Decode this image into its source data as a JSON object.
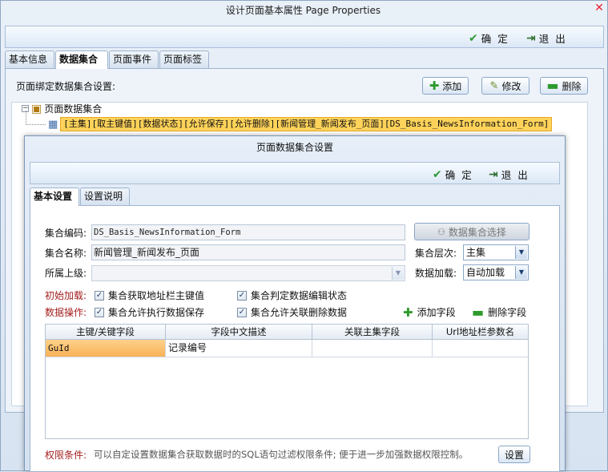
{
  "outer": {
    "title": "设计页面基本属性  Page Properties",
    "close": "✕",
    "toolbar": {
      "ok": "确 定",
      "exit": "退 出"
    },
    "tabs": [
      "基本信息",
      "数据集合",
      "页面事件",
      "页面标签"
    ],
    "active_tab": "数据集合",
    "binding_label": "页面绑定数据集合设置:",
    "buttons": {
      "add": "添加",
      "edit": "修改",
      "delete": "删除"
    },
    "tree": {
      "root": "页面数据集合",
      "child": "[主集][取主键值][数据状态][允许保存][允许删除][新闻管理_新闻发布_页面][DS_Basis_NewsInformation_Form]"
    }
  },
  "dialog": {
    "title": "页面数据集合设置",
    "toolbar": {
      "ok": "确 定",
      "exit": "退 出"
    },
    "tabs": [
      "基本设置",
      "设置说明"
    ],
    "active_tab": "基本设置",
    "fields": {
      "code_label": "集合编码:",
      "code_value": "DS_Basis_NewsInformation_Form",
      "select_button": "数据集合选择",
      "name_label": "集合名称:",
      "name_value": "新闻管理_新闻发布_页面",
      "level_label": "集合层次:",
      "level_value": "主集",
      "parent_label": "所属上级:",
      "parent_value": "",
      "load_label": "数据加载:",
      "load_value": "自动加载"
    },
    "init_load": {
      "label": "初始加载:",
      "opt1": "集合获取地址栏主键值",
      "opt2": "集合判定数据编辑状态"
    },
    "data_ops": {
      "label": "数据操作:",
      "opt1": "集合允许执行数据保存",
      "opt2": "集合允许关联删除数据"
    },
    "add_field": "添加字段",
    "delete_field": "删除字段",
    "grid": {
      "columns": [
        "主键/关键字段",
        "字段中文描述",
        "关联主集字段",
        "Url地址栏参数名"
      ],
      "rows": [
        [
          "GuId",
          "记录编号",
          "",
          ""
        ]
      ]
    },
    "permission": {
      "label": "权限条件:",
      "desc": "可以自定设置数据集合获取数据时的SQL语句过滤权限条件; 便于进一步加强数据权限控制。",
      "button": "设置"
    }
  }
}
